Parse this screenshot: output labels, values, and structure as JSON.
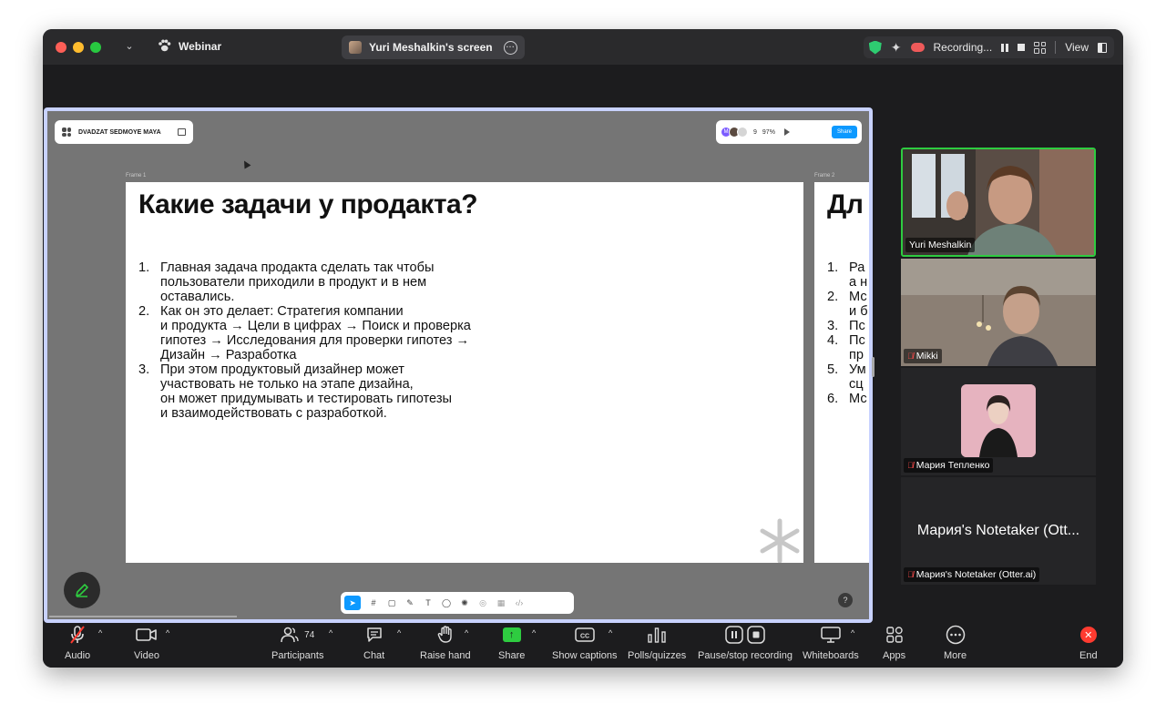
{
  "titlebar": {
    "app_name": "Webinar",
    "screen_label": "Yuri Meshalkin's screen",
    "recording_label": "Recording...",
    "view_label": "View",
    "colors": {
      "shield": "#2ecc71",
      "record": "#ef5a5a"
    }
  },
  "figma": {
    "file_name": "DVADZAT SEDMOYE MAYA",
    "collaborator_initial": "M",
    "collaborator_count": "9",
    "zoom": "97%",
    "share_label": "Share",
    "frame1_label": "Frame 1",
    "frame2_label": "Frame 2",
    "help_label": "?"
  },
  "slide1": {
    "title": "Какие задачи у продакта?",
    "items": [
      {
        "num": "1.",
        "text": "Главная задача продакта сделать так чтобы\nпользователи приходили в продукт и в нем\nоставались."
      },
      {
        "num": "2.",
        "text": "Как он это делает: Стратегия компании\nи продукта → Цели в цифрах → Поиск и проверка\nгипотез → Исследования для проверки гипотез →\nДизайн → Разработка"
      },
      {
        "num": "3.",
        "text": "При этом продуктовый дизайнер может\nучаствовать не только на этапе дизайна,\nон может придумывать и тестировать гипотезы\nи взаимодействовать с разработкой."
      }
    ]
  },
  "slide2": {
    "title": "Дл",
    "rows": [
      {
        "num": "1.",
        "text": "Ра"
      },
      {
        "num": "",
        "text": "а н"
      },
      {
        "num": "2.",
        "text": "Мс"
      },
      {
        "num": "",
        "text": "и б"
      },
      {
        "num": "3.",
        "text": "Пс"
      },
      {
        "num": "4.",
        "text": "Пс"
      },
      {
        "num": "",
        "text": "пр"
      },
      {
        "num": "5.",
        "text": "Ум"
      },
      {
        "num": "",
        "text": "сц"
      },
      {
        "num": "6.",
        "text": "Мс"
      }
    ]
  },
  "participants": [
    {
      "name": "Yuri Meshalkin",
      "muted": false,
      "active_speaker": true
    },
    {
      "name": "Mikki",
      "muted": true
    },
    {
      "name": "Мария Тепленко",
      "muted": true
    },
    {
      "name": "Мария's Notetaker (Otter.ai)",
      "display_name": "Мария's Notetaker (Ott...",
      "muted": true
    }
  ],
  "controls": {
    "audio": "Audio",
    "video": "Video",
    "participants": "Participants",
    "participant_count": "74",
    "chat": "Chat",
    "raise_hand": "Raise hand",
    "share": "Share",
    "captions": "Show captions",
    "polls": "Polls/quizzes",
    "recording": "Pause/stop recording",
    "whiteboards": "Whiteboards",
    "apps": "Apps",
    "more": "More",
    "end": "End",
    "colors": {
      "share": "#2ecc40",
      "end": "#ff3b30",
      "muted": "#ff4b4b"
    }
  }
}
